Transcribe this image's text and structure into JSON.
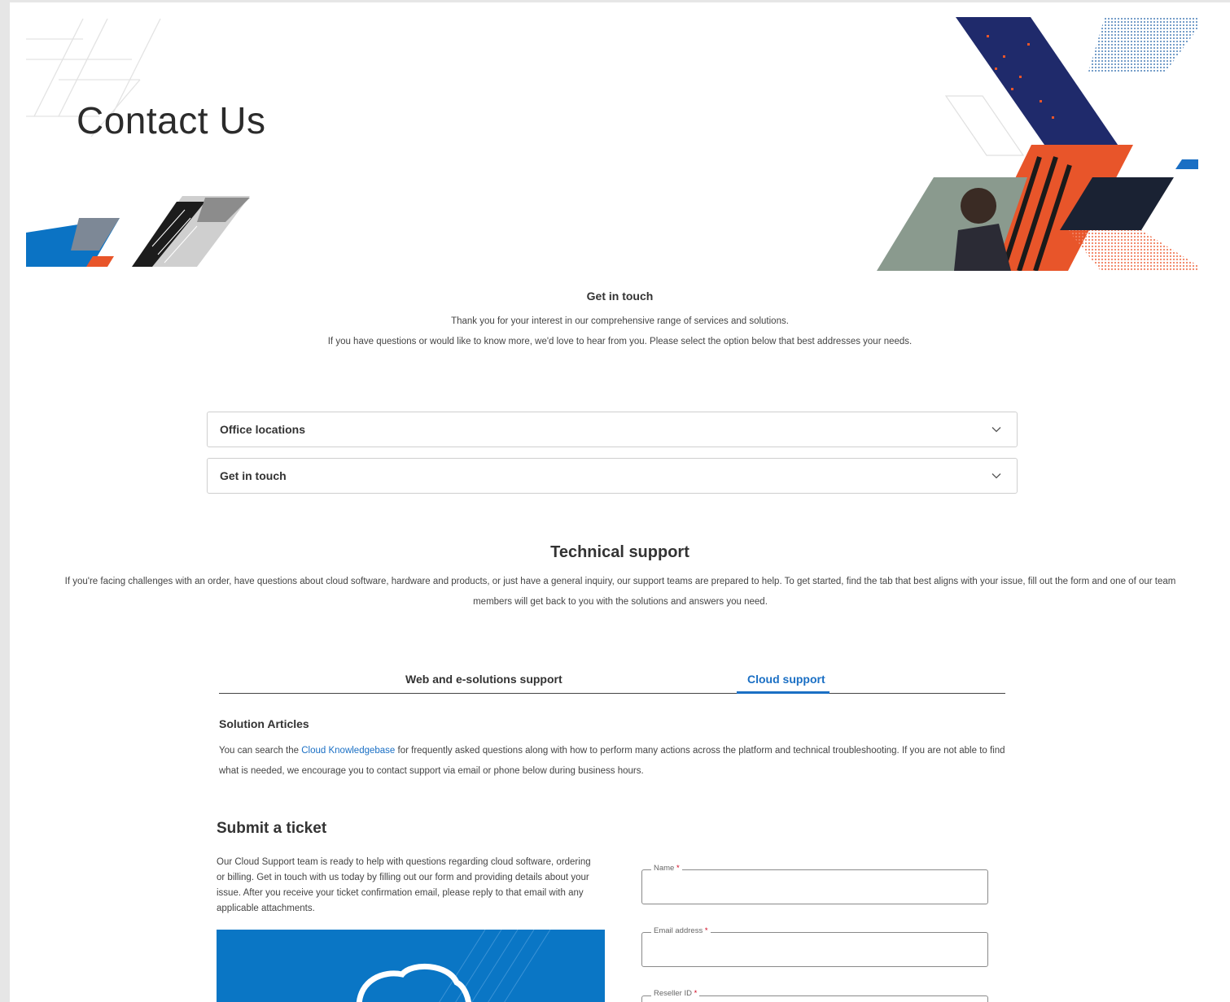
{
  "hero": {
    "title": "Contact Us"
  },
  "intro": {
    "heading": "Get in touch",
    "line1": "Thank you for your interest in our comprehensive range of services and solutions.",
    "line2": "If you have questions or would like to know more, we'd love to hear from you. Please select the option below that best addresses your needs."
  },
  "accordions": [
    {
      "label": "Office locations"
    },
    {
      "label": "Get in touch"
    }
  ],
  "tech_support": {
    "title": "Technical support",
    "description": "If you're facing challenges with an order, have questions about cloud software, hardware and products, or just have a general inquiry, our support teams are prepared to help. To get started, find the tab that best aligns with your issue, fill out the form and one of our team members will get back to you with the solutions and answers you need."
  },
  "tabs": [
    {
      "label": "Web and e-solutions support",
      "active": false
    },
    {
      "label": "Cloud support",
      "active": true
    }
  ],
  "solution_articles": {
    "title": "Solution Articles",
    "text_before": "You can search the ",
    "link": "Cloud Knowledgebase",
    "text_after": " for frequently asked questions along with how to perform many actions across the platform and technical troubleshooting. If you are not able to find what is needed, we encourage you to contact support via email or phone below during business hours."
  },
  "ticket": {
    "title": "Submit a ticket",
    "description": "Our Cloud Support team is ready to help with questions regarding cloud software, ordering or billing. Get in touch with us today by filling out our form and providing details about your issue. After you receive your ticket confirmation email, please reply to that email with any applicable attachments."
  },
  "form": {
    "name_label": "Name",
    "email_label": "Email address",
    "reseller_label": "Reseller ID",
    "required_mark": "*"
  },
  "colors": {
    "accent_blue": "#1a6fc4",
    "navy": "#1f2a6b",
    "orange": "#e8552a",
    "promo_blue": "#0a76c5"
  }
}
